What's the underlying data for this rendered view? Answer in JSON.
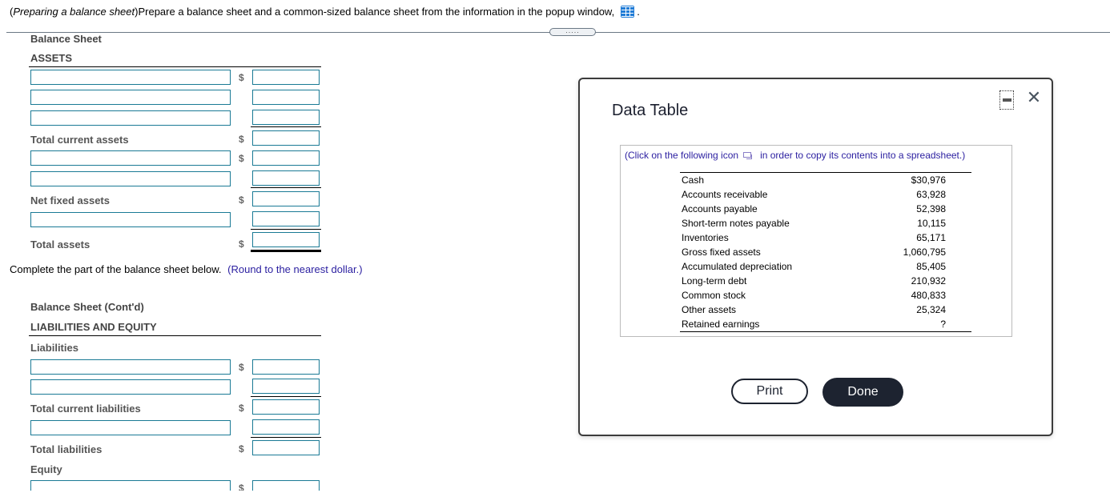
{
  "question": {
    "topic": "Preparing a balance sheet",
    "text": " Prepare a balance sheet and a common-sized balance sheet from the information in the popup window,",
    "trailing": ".",
    "icon": "data-table-grid-icon"
  },
  "splitter": {
    "label": "....."
  },
  "balance_sheet": {
    "title": "Balance Sheet",
    "assets_heading": "ASSETS",
    "currency_symbol": "$",
    "labels": {
      "total_current_assets": "Total current assets",
      "net_fixed_assets": "Net fixed assets",
      "total_assets": "Total assets"
    }
  },
  "instruction": {
    "text": "Complete the part of the balance sheet below.",
    "hint": "(Round to the nearest dollar.)"
  },
  "balance_sheet_contd": {
    "title": "Balance Sheet (Cont'd)",
    "heading": "LIABILITIES AND EQUITY",
    "liabilities_label": "Liabilities",
    "total_current_liabilities": "Total current liabilities",
    "total_liabilities": "Total liabilities",
    "equity_label": "Equity",
    "currency_symbol": "$"
  },
  "modal": {
    "title": "Data Table",
    "minimize_icon": "minimize-icon",
    "close_label": "✕",
    "copy_note_before": "(Click on the following icon",
    "copy_note_after": "in order to copy its contents into a spreadsheet.)",
    "rows": [
      {
        "label": "Cash",
        "value": "$30,976"
      },
      {
        "label": "Accounts receivable",
        "value": "63,928"
      },
      {
        "label": "Accounts payable",
        "value": "52,398"
      },
      {
        "label": "Short-term notes payable",
        "value": "10,115"
      },
      {
        "label": "Inventories",
        "value": "65,171"
      },
      {
        "label": "Gross fixed assets",
        "value": "1,060,795"
      },
      {
        "label": "Accumulated depreciation",
        "value": "85,405"
      },
      {
        "label": "Long-term debt",
        "value": "210,932"
      },
      {
        "label": "Common stock",
        "value": "480,833"
      },
      {
        "label": "Other assets",
        "value": "25,324"
      },
      {
        "label": "Retained earnings",
        "value": "?"
      }
    ],
    "print_label": "Print",
    "done_label": "Done"
  }
}
